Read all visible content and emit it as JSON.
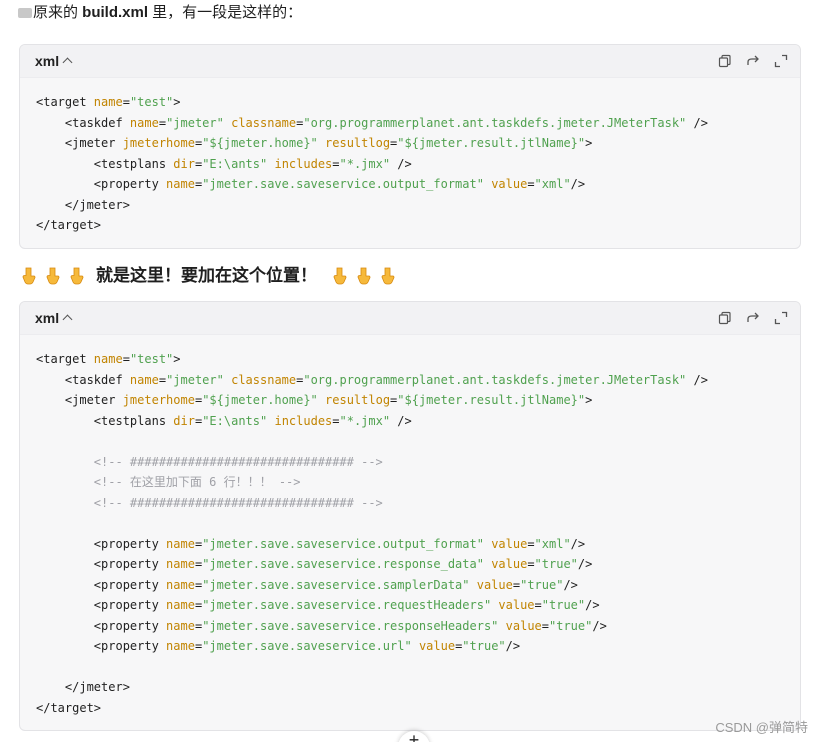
{
  "intro": {
    "prefix": "原来的 ",
    "bold": "build.xml",
    "suffix": " 里，有一段是这样的："
  },
  "block1": {
    "lang": "xml",
    "lines": [
      [
        [
          "tag",
          "<target "
        ],
        [
          "attr",
          "name"
        ],
        [
          "tag",
          "="
        ],
        [
          "str",
          "\"test\""
        ],
        [
          "tag",
          ">"
        ]
      ],
      [
        [
          "tag",
          "    <taskdef "
        ],
        [
          "attr",
          "name"
        ],
        [
          "tag",
          "="
        ],
        [
          "str",
          "\"jmeter\""
        ],
        [
          "tag",
          " "
        ],
        [
          "attr",
          "classname"
        ],
        [
          "tag",
          "="
        ],
        [
          "str",
          "\"org.programmerplanet.ant.taskdefs.jmeter.JMeterTask\""
        ],
        [
          "tag",
          " />"
        ]
      ],
      [
        [
          "tag",
          "    <jmeter "
        ],
        [
          "attr",
          "jmeterhome"
        ],
        [
          "tag",
          "="
        ],
        [
          "str",
          "\"${jmeter.home}\""
        ],
        [
          "tag",
          " "
        ],
        [
          "attr",
          "resultlog"
        ],
        [
          "tag",
          "="
        ],
        [
          "str",
          "\"${jmeter.result.jtlName}\""
        ],
        [
          "tag",
          ">"
        ]
      ],
      [
        [
          "tag",
          "        <testplans "
        ],
        [
          "attr",
          "dir"
        ],
        [
          "tag",
          "="
        ],
        [
          "str",
          "\"E:\\ants\""
        ],
        [
          "tag",
          " "
        ],
        [
          "attr",
          "includes"
        ],
        [
          "tag",
          "="
        ],
        [
          "str",
          "\"*.jmx\""
        ],
        [
          "tag",
          " />"
        ]
      ],
      [
        [
          "tag",
          "        <property "
        ],
        [
          "attr",
          "name"
        ],
        [
          "tag",
          "="
        ],
        [
          "str",
          "\"jmeter.save.saveservice.output_format\""
        ],
        [
          "tag",
          " "
        ],
        [
          "attr",
          "value"
        ],
        [
          "tag",
          "="
        ],
        [
          "str",
          "\"xml\""
        ],
        [
          "tag",
          "/>"
        ]
      ],
      [
        [
          "tag",
          "    </jmeter>"
        ]
      ],
      [
        [
          "tag",
          "</target>"
        ]
      ]
    ]
  },
  "heading": {
    "text": "就是这里！要加在这个位置！"
  },
  "block2": {
    "lang": "xml",
    "lines": [
      [
        [
          "tag",
          "<target "
        ],
        [
          "attr",
          "name"
        ],
        [
          "tag",
          "="
        ],
        [
          "str",
          "\"test\""
        ],
        [
          "tag",
          ">"
        ]
      ],
      [
        [
          "tag",
          "    <taskdef "
        ],
        [
          "attr",
          "name"
        ],
        [
          "tag",
          "="
        ],
        [
          "str",
          "\"jmeter\""
        ],
        [
          "tag",
          " "
        ],
        [
          "attr",
          "classname"
        ],
        [
          "tag",
          "="
        ],
        [
          "str",
          "\"org.programmerplanet.ant.taskdefs.jmeter.JMeterTask\""
        ],
        [
          "tag",
          " />"
        ]
      ],
      [
        [
          "tag",
          "    <jmeter "
        ],
        [
          "attr",
          "jmeterhome"
        ],
        [
          "tag",
          "="
        ],
        [
          "str",
          "\"${jmeter.home}\""
        ],
        [
          "tag",
          " "
        ],
        [
          "attr",
          "resultlog"
        ],
        [
          "tag",
          "="
        ],
        [
          "str",
          "\"${jmeter.result.jtlName}\""
        ],
        [
          "tag",
          ">"
        ]
      ],
      [
        [
          "tag",
          "        <testplans "
        ],
        [
          "attr",
          "dir"
        ],
        [
          "tag",
          "="
        ],
        [
          "str",
          "\"E:\\ants\""
        ],
        [
          "tag",
          " "
        ],
        [
          "attr",
          "includes"
        ],
        [
          "tag",
          "="
        ],
        [
          "str",
          "\"*.jmx\""
        ],
        [
          "tag",
          " />"
        ]
      ],
      [
        [
          "tag",
          ""
        ]
      ],
      [
        [
          "cmt",
          "        <!-- ############################### -->"
        ]
      ],
      [
        [
          "cmt",
          "        <!-- 在这里加下面 6 行！！！ -->"
        ]
      ],
      [
        [
          "cmt",
          "        <!-- ############################### -->"
        ]
      ],
      [
        [
          "tag",
          ""
        ]
      ],
      [
        [
          "tag",
          "        <property "
        ],
        [
          "attr",
          "name"
        ],
        [
          "tag",
          "="
        ],
        [
          "str",
          "\"jmeter.save.saveservice.output_format\""
        ],
        [
          "tag",
          " "
        ],
        [
          "attr",
          "value"
        ],
        [
          "tag",
          "="
        ],
        [
          "str",
          "\"xml\""
        ],
        [
          "tag",
          "/>"
        ]
      ],
      [
        [
          "tag",
          "        <property "
        ],
        [
          "attr",
          "name"
        ],
        [
          "tag",
          "="
        ],
        [
          "str",
          "\"jmeter.save.saveservice.response_data\""
        ],
        [
          "tag",
          " "
        ],
        [
          "attr",
          "value"
        ],
        [
          "tag",
          "="
        ],
        [
          "str",
          "\"true\""
        ],
        [
          "tag",
          "/>"
        ]
      ],
      [
        [
          "tag",
          "        <property "
        ],
        [
          "attr",
          "name"
        ],
        [
          "tag",
          "="
        ],
        [
          "str",
          "\"jmeter.save.saveservice.samplerData\""
        ],
        [
          "tag",
          " "
        ],
        [
          "attr",
          "value"
        ],
        [
          "tag",
          "="
        ],
        [
          "str",
          "\"true\""
        ],
        [
          "tag",
          "/>"
        ]
      ],
      [
        [
          "tag",
          "        <property "
        ],
        [
          "attr",
          "name"
        ],
        [
          "tag",
          "="
        ],
        [
          "str",
          "\"jmeter.save.saveservice.requestHeaders\""
        ],
        [
          "tag",
          " "
        ],
        [
          "attr",
          "value"
        ],
        [
          "tag",
          "="
        ],
        [
          "str",
          "\"true\""
        ],
        [
          "tag",
          "/>"
        ]
      ],
      [
        [
          "tag",
          "        <property "
        ],
        [
          "attr",
          "name"
        ],
        [
          "tag",
          "="
        ],
        [
          "str",
          "\"jmeter.save.saveservice.responseHeaders\""
        ],
        [
          "tag",
          " "
        ],
        [
          "attr",
          "value"
        ],
        [
          "tag",
          "="
        ],
        [
          "str",
          "\"true\""
        ],
        [
          "tag",
          "/>"
        ]
      ],
      [
        [
          "tag",
          "        <property "
        ],
        [
          "attr",
          "name"
        ],
        [
          "tag",
          "="
        ],
        [
          "str",
          "\"jmeter.save.saveservice.url\""
        ],
        [
          "tag",
          " "
        ],
        [
          "attr",
          "value"
        ],
        [
          "tag",
          "="
        ],
        [
          "str",
          "\"true\""
        ],
        [
          "tag",
          "/>"
        ]
      ],
      [
        [
          "tag",
          ""
        ]
      ],
      [
        [
          "tag",
          "    </jmeter>"
        ]
      ],
      [
        [
          "tag",
          "</target>"
        ]
      ]
    ]
  },
  "icons": {
    "copy": "copy-icon",
    "share": "share-icon",
    "expand": "expand-icon",
    "hand": "pointing-down-hand-icon"
  },
  "colors": {
    "attr": "#c18401",
    "string": "#50a14f",
    "comment": "#a0a1a7",
    "card_bg": "#f7f7f8"
  },
  "watermark": "CSDN @弹简特",
  "scroll_button": "+"
}
